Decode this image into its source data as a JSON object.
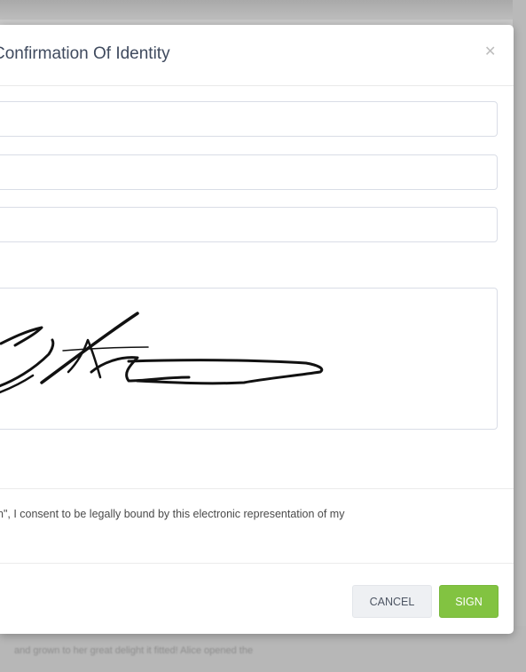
{
  "background": {
    "text_line_1": "and grown to her great delight it fitted! Alice opened the"
  },
  "modal": {
    "title": "Confirmation Of Identity",
    "close_icon": "close-icon",
    "fields": [
      {
        "value": "",
        "placeholder": ""
      },
      {
        "value": "",
        "placeholder": ""
      },
      {
        "value": "",
        "placeholder": ""
      }
    ],
    "signature_pad": {
      "has_signature": true
    },
    "clear_label": "",
    "consent_text": "n\", I consent to be legally bound by this electronic representation of my",
    "buttons": {
      "cancel": "CANCEL",
      "sign": "SIGN"
    }
  },
  "colors": {
    "title": "#3f4a5e",
    "sign_button": "#82c341",
    "cancel_button": "#eef0f3",
    "field_border": "#d9dde6"
  }
}
